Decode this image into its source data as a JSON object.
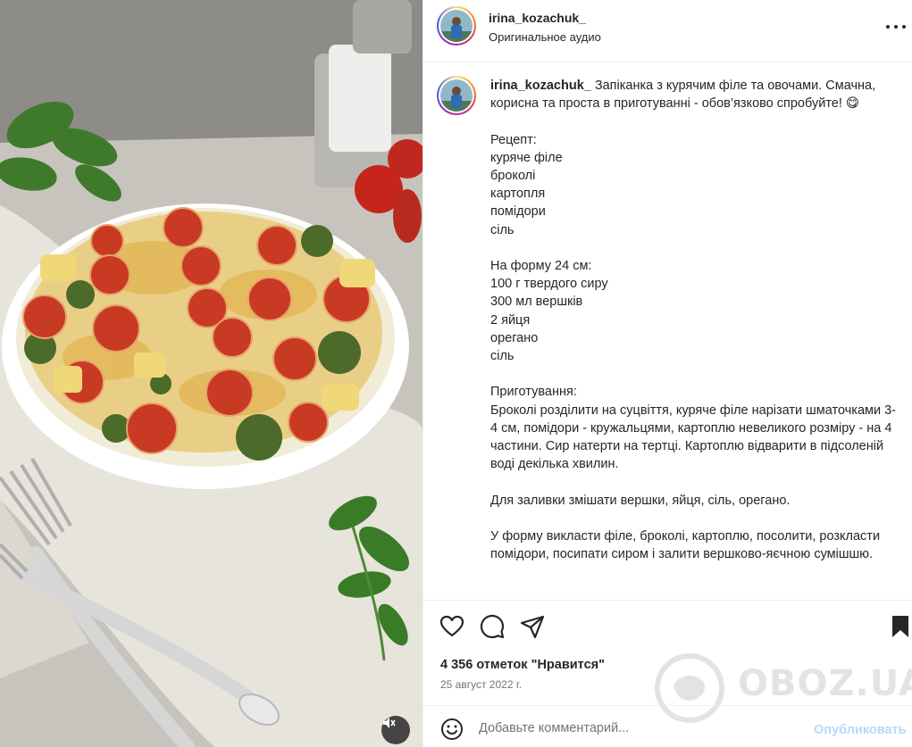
{
  "post": {
    "username": "irina_kozachuk_",
    "audio_label": "Оригинальное аудио",
    "caption_username": "irina_kozachuk_",
    "caption_body": " Запіканка з курячим філе та овочами. Смачна, корисна та проста в приготуванні - обов’язково спробуйте! 😋\n\nРецепт:\nкуряче філе\nброколі\nкартопля\nпомідори\nсіль\n\nНа форму 24 см:\n100 г твердого сиру\n300 мл вершків\n2 яйця\nорегано\nсіль\n\nПриготування:\nБроколі розділити на суцвіття, куряче філе нарізати шматочками 3-4 см, помідори - кружальцями, картоплю невеликого розміру - на 4 частини. Сир натерти на тертці. Картоплю відварити в підсоленій воді декілька хвилин.\n\nДля заливки змішати вершки, яйця, сіль, орегано.\n\nУ форму викласти філе, броколі, картоплю, посолити, розкласти помідори, посипати сиром і залити вершково-яєчною сумішшю."
  },
  "actions": {
    "likes_text": "4 356 отметок \"Нравится\"",
    "date_text": "25 август 2022 г."
  },
  "comment": {
    "placeholder": "Добавьте комментарий...",
    "publish_label": "Опубликовать"
  },
  "watermark": {
    "text": "OBOZ.UA"
  },
  "icons": {
    "more": "more-horizontal-icon",
    "like": "heart-icon",
    "comment": "comment-bubble-icon",
    "share": "paper-plane-icon",
    "save": "bookmark-icon",
    "emoji": "smiley-icon",
    "mute": "speaker-muted-icon"
  },
  "colors": {
    "text": "#262626",
    "secondary": "#737373",
    "publish_disabled": "#b3dbff",
    "divider": "#efefef"
  }
}
